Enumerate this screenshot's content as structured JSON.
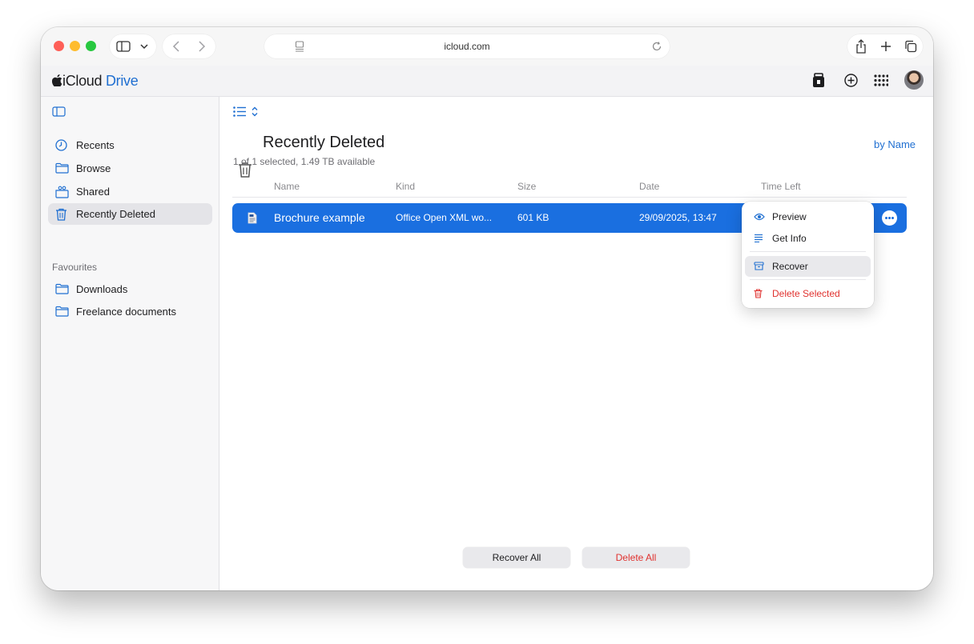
{
  "browser": {
    "address": "icloud.com"
  },
  "app": {
    "brand_prefix": "iCloud",
    "brand_suffix": "Drive"
  },
  "sidebar": {
    "items": [
      {
        "label": "Recents",
        "icon": "clock-icon"
      },
      {
        "label": "Browse",
        "icon": "folder-icon"
      },
      {
        "label": "Shared",
        "icon": "shared-folder-icon"
      },
      {
        "label": "Recently Deleted",
        "icon": "trash-icon",
        "selected": true
      }
    ],
    "section_title": "Favourites",
    "favourites": [
      {
        "label": "Downloads",
        "icon": "folder-icon"
      },
      {
        "label": "Freelance documents",
        "icon": "folder-icon"
      }
    ]
  },
  "main": {
    "title": "Recently Deleted",
    "subtitle": "1 of 1 selected, 1.49 TB available",
    "sort_label": "by Name",
    "columns": [
      "Name",
      "Kind",
      "Size",
      "Date",
      "Time Left"
    ],
    "rows": [
      {
        "name": "Brochure example",
        "kind": "Office Open XML wo...",
        "size": "601 KB",
        "date": "29/09/2025, 13:47",
        "selected": true
      }
    ]
  },
  "context_menu": {
    "items": [
      {
        "label": "Preview",
        "icon": "eye-icon"
      },
      {
        "label": "Get Info",
        "icon": "info-lines-icon"
      },
      {
        "label": "Recover",
        "icon": "recover-box-icon",
        "highlighted": true
      },
      {
        "label": "Delete Selected",
        "icon": "trash-icon",
        "danger": true
      }
    ]
  },
  "footer": {
    "recover_all": "Recover All",
    "delete_all": "Delete All"
  },
  "colors": {
    "accent": "#1a6fe0",
    "danger": "#e0322f"
  }
}
